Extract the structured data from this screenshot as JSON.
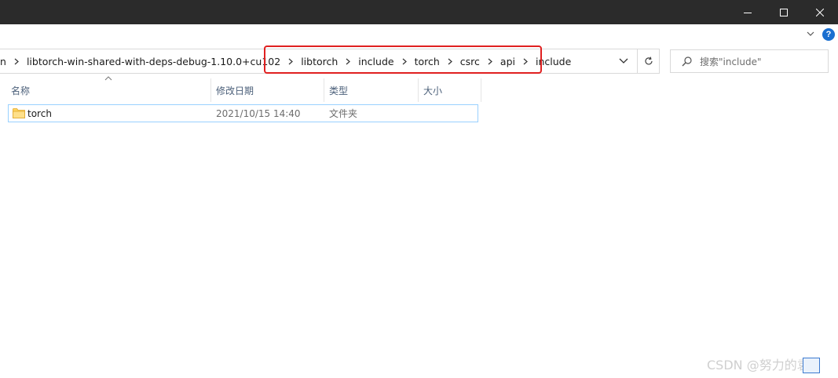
{
  "window": {
    "controls": {
      "minimize_icon": "minimize-icon",
      "maximize_icon": "maximize-icon",
      "close_icon": "close-icon"
    }
  },
  "ribbon": {
    "expand_icon": "chevron-down-icon",
    "help_label": "?"
  },
  "address": {
    "crumbs": [
      {
        "label": "n"
      },
      {
        "label": "libtorch-win-shared-with-deps-debug-1.10.0+cu102"
      },
      {
        "label": "libtorch"
      },
      {
        "label": "include"
      },
      {
        "label": "torch"
      },
      {
        "label": "csrc"
      },
      {
        "label": "api"
      },
      {
        "label": "include"
      }
    ],
    "dropdown_icon": "chevron-down-icon",
    "refresh_icon": "refresh-icon"
  },
  "search": {
    "placeholder": "搜索\"include\""
  },
  "columns": {
    "name": "名称",
    "modified": "修改日期",
    "type": "类型",
    "size": "大小"
  },
  "files": [
    {
      "name": "torch",
      "modified": "2021/10/15 14:40",
      "type": "文件夹",
      "size": ""
    }
  ],
  "watermark": "CSDN @努力的袁",
  "colors": {
    "titlebar": "#2b2b2b",
    "highlight": "#e02020",
    "selection_border": "#99d1ff",
    "folder": "#ffd35c"
  }
}
